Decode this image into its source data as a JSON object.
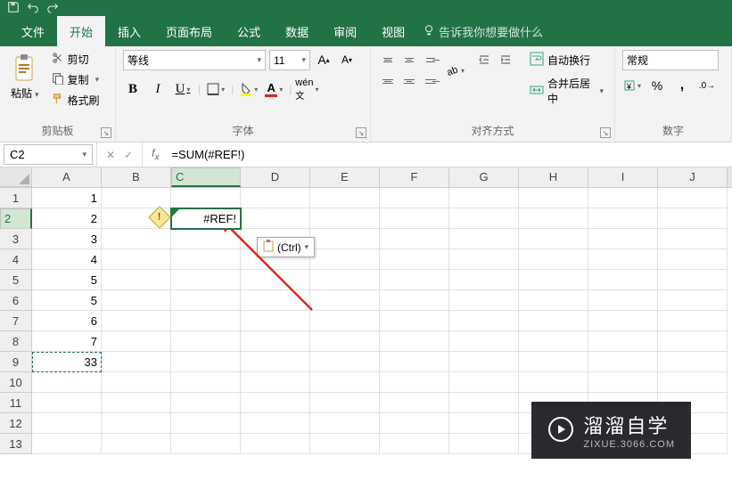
{
  "tabs": {
    "file": "文件",
    "home": "开始",
    "insert": "插入",
    "layout": "页面布局",
    "formula": "公式",
    "data": "数据",
    "review": "审阅",
    "view": "视图"
  },
  "tell_me": "告诉我你想要做什么",
  "clipboard": {
    "paste": "粘贴",
    "cut": "剪切",
    "copy": "复制",
    "format_painter": "格式刷",
    "label": "剪贴板"
  },
  "font": {
    "name": "等线",
    "size": "11",
    "label": "字体"
  },
  "align": {
    "wrap": "自动换行",
    "merge": "合并后居中",
    "label": "对齐方式"
  },
  "number": {
    "format": "常规",
    "label": "数字"
  },
  "namebox": "C2",
  "formula": "=SUM(#REF!)",
  "columns": [
    "A",
    "B",
    "C",
    "D",
    "E",
    "F",
    "G",
    "H",
    "I",
    "J"
  ],
  "row_count": 13,
  "cells": {
    "A1": "1",
    "A2": "2",
    "A3": "3",
    "A4": "4",
    "A5": "5",
    "A6": "5",
    "A7": "6",
    "A8": "7",
    "A9": "33",
    "C2": "#REF!"
  },
  "paste_smart": "(Ctrl)",
  "watermark": {
    "main": "溜溜自学",
    "sub": "ZIXUE.3066.COM"
  }
}
